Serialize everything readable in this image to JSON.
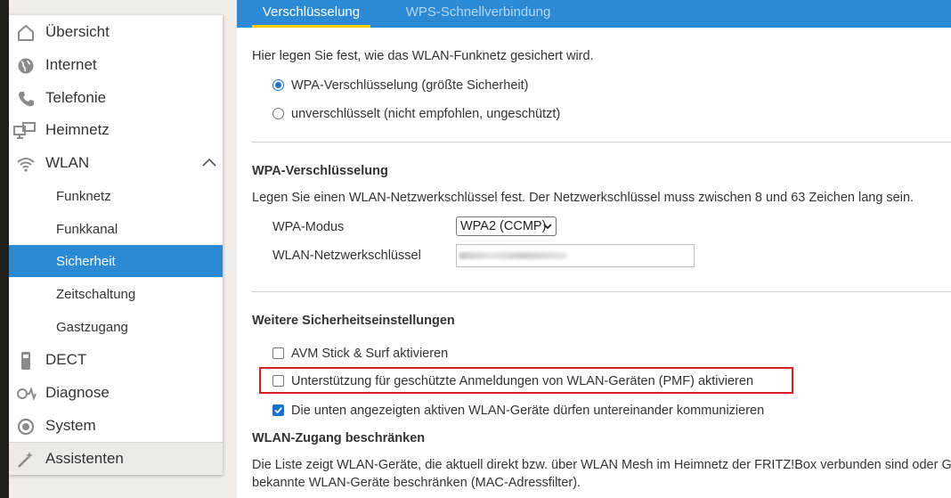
{
  "sidebar": {
    "items": [
      {
        "label": "Übersicht",
        "icon": "home-icon"
      },
      {
        "label": "Internet",
        "icon": "globe-icon"
      },
      {
        "label": "Telefonie",
        "icon": "phone-icon"
      },
      {
        "label": "Heimnetz",
        "icon": "network-icon"
      },
      {
        "label": "WLAN",
        "icon": "wifi-icon",
        "expanded": true
      }
    ],
    "wlan_subitems": [
      "Funknetz",
      "Funkkanal",
      "Sicherheit",
      "Zeitschaltung",
      "Gastzugang"
    ],
    "active_subitem": "Sicherheit",
    "items_after": [
      {
        "label": "DECT",
        "icon": "dect-phone-icon"
      },
      {
        "label": "Diagnose",
        "icon": "diagnose-icon"
      },
      {
        "label": "System",
        "icon": "system-icon"
      },
      {
        "label": "Assistenten",
        "icon": "wizard-icon"
      }
    ]
  },
  "tabs": [
    {
      "label": "Verschlüsselung",
      "active": true
    },
    {
      "label": "WPS-Schnellverbindung",
      "active": false
    }
  ],
  "main": {
    "intro": "Hier legen Sie fest, wie das WLAN-Funknetz gesichert wird.",
    "radio_wpa": "WPA-Verschlüsselung (größte Sicherheit)",
    "radio_wpa_checked": true,
    "radio_none": "unverschlüsselt (nicht empfohlen, ungeschützt)",
    "radio_none_checked": false,
    "wpa_heading": "WPA-Verschlüsselung",
    "wpa_desc": "Legen Sie einen WLAN-Netzwerkschlüssel fest. Der Netzwerkschlüssel muss zwischen 8 und 63 Zeichen lang sein.",
    "wpa_mode_label": "WPA-Modus",
    "wpa_mode_value": "WPA2 (CCMP)",
    "key_label": "WLAN-Netzwerkschlüssel",
    "security_heading": "Weitere Sicherheitseinstellungen",
    "avm_stick": "AVM Stick & Surf aktivieren",
    "avm_stick_checked": false,
    "pmf": "Unterstützung für geschützte Anmeldungen von WLAN-Geräten (PMF) aktivieren",
    "pmf_checked": false,
    "communicate": "Die unten angezeigten aktiven WLAN-Geräte dürfen untereinander kommunizieren",
    "communicate_checked": true,
    "restrict_heading": "WLAN-Zugang beschränken",
    "restrict_desc_1": "Die Liste zeigt WLAN-Geräte, die aktuell direkt bzw. über WLAN Mesh im Heimnetz der FRITZ!Box verbunden sind oder G",
    "restrict_desc_2": "bekannte WLAN-Geräte beschränken (MAC-Adressfilter)."
  },
  "colors": {
    "accent": "#2b8ad3",
    "tab_underline": "#ffcc00",
    "highlight_box": "#d72128",
    "checkbox": "#1a73c8"
  }
}
